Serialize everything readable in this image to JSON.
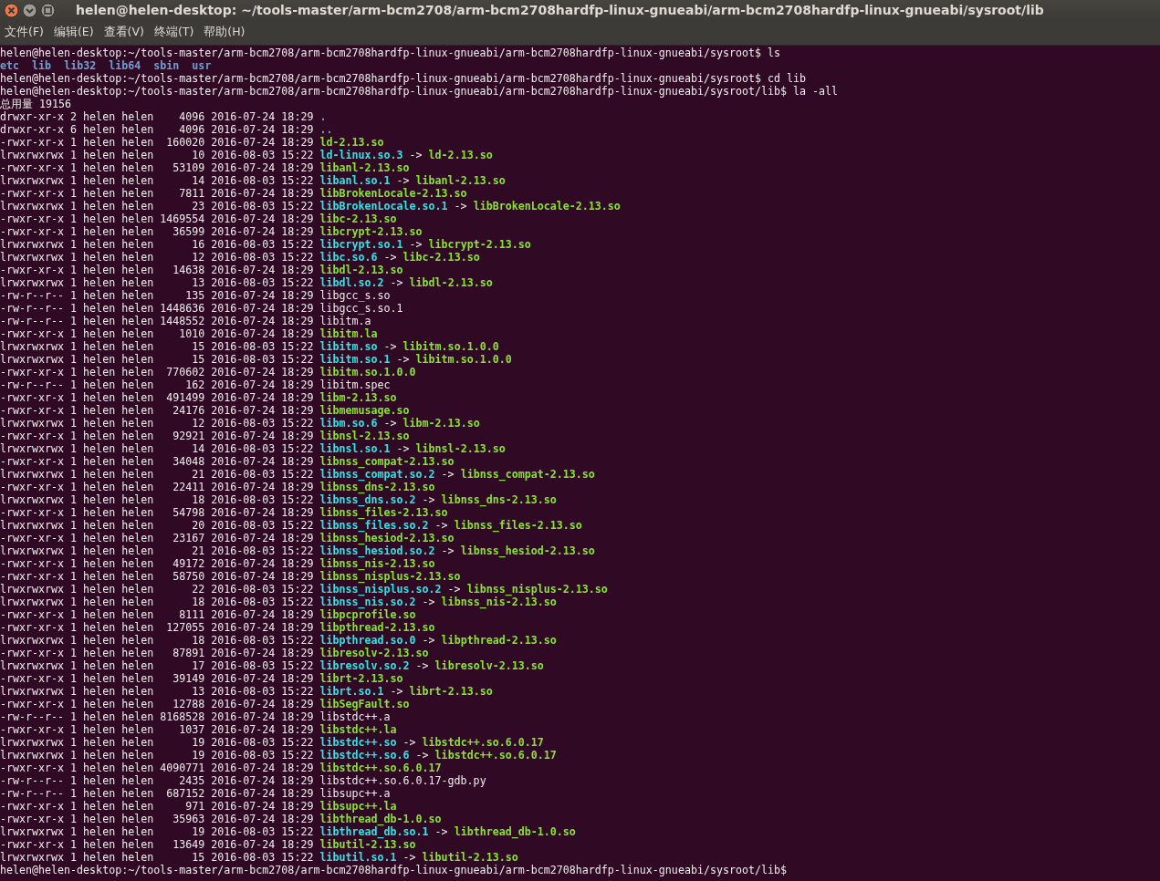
{
  "window": {
    "title": "helen@helen-desktop: ~/tools-master/arm-bcm2708/arm-bcm2708hardfp-linux-gnueabi/arm-bcm2708hardfp-linux-gnueabi/sysroot/lib"
  },
  "menu": [
    "文件(F)",
    "编辑(E)",
    "查看(V)",
    "终端(T)",
    "帮助(H)"
  ],
  "terminal": {
    "lines": [
      {
        "kind": "prompt",
        "text": "helen@helen-desktop:~/tools-master/arm-bcm2708/arm-bcm2708hardfp-linux-gnueabi/arm-bcm2708hardfp-linux-gnueabi/sysroot$ ls"
      },
      {
        "kind": "names",
        "items": [
          "etc",
          "lib",
          "lib32",
          "lib64",
          "sbin",
          "usr"
        ]
      },
      {
        "kind": "prompt",
        "text": "helen@helen-desktop:~/tools-master/arm-bcm2708/arm-bcm2708hardfp-linux-gnueabi/arm-bcm2708hardfp-linux-gnueabi/sysroot$ cd lib"
      },
      {
        "kind": "prompt",
        "text": "helen@helen-desktop:~/tools-master/arm-bcm2708/arm-bcm2708hardfp-linux-gnueabi/arm-bcm2708hardfp-linux-gnueabi/sysroot/lib$ la -all"
      },
      {
        "kind": "total",
        "text": "总用量 19156"
      },
      {
        "kind": "dir",
        "info": "drwxr-xr-x 2 helen helen    4096 2016-07-24 18:29",
        "name": "."
      },
      {
        "kind": "dir",
        "info": "drwxr-xr-x 6 helen helen    4096 2016-07-24 18:29",
        "name": ".."
      },
      {
        "kind": "exec",
        "info": "-rwxr-xr-x 1 helen helen  160020 2016-07-24 18:29",
        "name": "ld-2.13.so"
      },
      {
        "kind": "link",
        "info": "lrwxrwxrwx 1 helen helen      10 2016-08-03 15:22",
        "name": "ld-linux.so.3",
        "arrow": "->",
        "target": "ld-2.13.so"
      },
      {
        "kind": "exec",
        "info": "-rwxr-xr-x 1 helen helen   53109 2016-07-24 18:29",
        "name": "libanl-2.13.so"
      },
      {
        "kind": "link",
        "info": "lrwxrwxrwx 1 helen helen      14 2016-08-03 15:22",
        "name": "libanl.so.1",
        "arrow": "->",
        "target": "libanl-2.13.so"
      },
      {
        "kind": "exec",
        "info": "-rwxr-xr-x 1 helen helen    7811 2016-07-24 18:29",
        "name": "libBrokenLocale-2.13.so"
      },
      {
        "kind": "link",
        "info": "lrwxrwxrwx 1 helen helen      23 2016-08-03 15:22",
        "name": "libBrokenLocale.so.1",
        "arrow": "->",
        "target": "libBrokenLocale-2.13.so"
      },
      {
        "kind": "exec",
        "info": "-rwxr-xr-x 1 helen helen 1469554 2016-07-24 18:29",
        "name": "libc-2.13.so"
      },
      {
        "kind": "exec",
        "info": "-rwxr-xr-x 1 helen helen   36599 2016-07-24 18:29",
        "name": "libcrypt-2.13.so"
      },
      {
        "kind": "link",
        "info": "lrwxrwxrwx 1 helen helen      16 2016-08-03 15:22",
        "name": "libcrypt.so.1",
        "arrow": "->",
        "target": "libcrypt-2.13.so"
      },
      {
        "kind": "link",
        "info": "lrwxrwxrwx 1 helen helen      12 2016-08-03 15:22",
        "name": "libc.so.6",
        "arrow": "->",
        "target": "libc-2.13.so"
      },
      {
        "kind": "exec",
        "info": "-rwxr-xr-x 1 helen helen   14638 2016-07-24 18:29",
        "name": "libdl-2.13.so"
      },
      {
        "kind": "link",
        "info": "lrwxrwxrwx 1 helen helen      13 2016-08-03 15:22",
        "name": "libdl.so.2",
        "arrow": "->",
        "target": "libdl-2.13.so"
      },
      {
        "kind": "file",
        "info": "-rw-r--r-- 1 helen helen     135 2016-07-24 18:29",
        "name": "libgcc_s.so"
      },
      {
        "kind": "file",
        "info": "-rw-r--r-- 1 helen helen 1448636 2016-07-24 18:29",
        "name": "libgcc_s.so.1"
      },
      {
        "kind": "file",
        "info": "-rw-r--r-- 1 helen helen 1448552 2016-07-24 18:29",
        "name": "libitm.a"
      },
      {
        "kind": "exec",
        "info": "-rwxr-xr-x 1 helen helen    1010 2016-07-24 18:29",
        "name": "libitm.la"
      },
      {
        "kind": "link",
        "info": "lrwxrwxrwx 1 helen helen      15 2016-08-03 15:22",
        "name": "libitm.so",
        "arrow": "->",
        "target": "libitm.so.1.0.0"
      },
      {
        "kind": "link",
        "info": "lrwxrwxrwx 1 helen helen      15 2016-08-03 15:22",
        "name": "libitm.so.1",
        "arrow": "->",
        "target": "libitm.so.1.0.0"
      },
      {
        "kind": "exec",
        "info": "-rwxr-xr-x 1 helen helen  770602 2016-07-24 18:29",
        "name": "libitm.so.1.0.0"
      },
      {
        "kind": "file",
        "info": "-rw-r--r-- 1 helen helen     162 2016-07-24 18:29",
        "name": "libitm.spec"
      },
      {
        "kind": "exec",
        "info": "-rwxr-xr-x 1 helen helen  491499 2016-07-24 18:29",
        "name": "libm-2.13.so"
      },
      {
        "kind": "exec",
        "info": "-rwxr-xr-x 1 helen helen   24176 2016-07-24 18:29",
        "name": "libmemusage.so"
      },
      {
        "kind": "link",
        "info": "lrwxrwxrwx 1 helen helen      12 2016-08-03 15:22",
        "name": "libm.so.6",
        "arrow": "->",
        "target": "libm-2.13.so"
      },
      {
        "kind": "exec",
        "info": "-rwxr-xr-x 1 helen helen   92921 2016-07-24 18:29",
        "name": "libnsl-2.13.so"
      },
      {
        "kind": "link",
        "info": "lrwxrwxrwx 1 helen helen      14 2016-08-03 15:22",
        "name": "libnsl.so.1",
        "arrow": "->",
        "target": "libnsl-2.13.so"
      },
      {
        "kind": "exec",
        "info": "-rwxr-xr-x 1 helen helen   34048 2016-07-24 18:29",
        "name": "libnss_compat-2.13.so"
      },
      {
        "kind": "link",
        "info": "lrwxrwxrwx 1 helen helen      21 2016-08-03 15:22",
        "name": "libnss_compat.so.2",
        "arrow": "->",
        "target": "libnss_compat-2.13.so"
      },
      {
        "kind": "exec",
        "info": "-rwxr-xr-x 1 helen helen   22411 2016-07-24 18:29",
        "name": "libnss_dns-2.13.so"
      },
      {
        "kind": "link",
        "info": "lrwxrwxrwx 1 helen helen      18 2016-08-03 15:22",
        "name": "libnss_dns.so.2",
        "arrow": "->",
        "target": "libnss_dns-2.13.so"
      },
      {
        "kind": "exec",
        "info": "-rwxr-xr-x 1 helen helen   54798 2016-07-24 18:29",
        "name": "libnss_files-2.13.so"
      },
      {
        "kind": "link",
        "info": "lrwxrwxrwx 1 helen helen      20 2016-08-03 15:22",
        "name": "libnss_files.so.2",
        "arrow": "->",
        "target": "libnss_files-2.13.so"
      },
      {
        "kind": "exec",
        "info": "-rwxr-xr-x 1 helen helen   23167 2016-07-24 18:29",
        "name": "libnss_hesiod-2.13.so"
      },
      {
        "kind": "link",
        "info": "lrwxrwxrwx 1 helen helen      21 2016-08-03 15:22",
        "name": "libnss_hesiod.so.2",
        "arrow": "->",
        "target": "libnss_hesiod-2.13.so"
      },
      {
        "kind": "exec",
        "info": "-rwxr-xr-x 1 helen helen   49172 2016-07-24 18:29",
        "name": "libnss_nis-2.13.so"
      },
      {
        "kind": "exec",
        "info": "-rwxr-xr-x 1 helen helen   58750 2016-07-24 18:29",
        "name": "libnss_nisplus-2.13.so"
      },
      {
        "kind": "link",
        "info": "lrwxrwxrwx 1 helen helen      22 2016-08-03 15:22",
        "name": "libnss_nisplus.so.2",
        "arrow": "->",
        "target": "libnss_nisplus-2.13.so"
      },
      {
        "kind": "link",
        "info": "lrwxrwxrwx 1 helen helen      18 2016-08-03 15:22",
        "name": "libnss_nis.so.2",
        "arrow": "->",
        "target": "libnss_nis-2.13.so"
      },
      {
        "kind": "exec",
        "info": "-rwxr-xr-x 1 helen helen    8111 2016-07-24 18:29",
        "name": "libpcprofile.so"
      },
      {
        "kind": "exec",
        "info": "-rwxr-xr-x 1 helen helen  127055 2016-07-24 18:29",
        "name": "libpthread-2.13.so"
      },
      {
        "kind": "link",
        "info": "lrwxrwxrwx 1 helen helen      18 2016-08-03 15:22",
        "name": "libpthread.so.0",
        "arrow": "->",
        "target": "libpthread-2.13.so"
      },
      {
        "kind": "exec",
        "info": "-rwxr-xr-x 1 helen helen   87891 2016-07-24 18:29",
        "name": "libresolv-2.13.so"
      },
      {
        "kind": "link",
        "info": "lrwxrwxrwx 1 helen helen      17 2016-08-03 15:22",
        "name": "libresolv.so.2",
        "arrow": "->",
        "target": "libresolv-2.13.so"
      },
      {
        "kind": "exec",
        "info": "-rwxr-xr-x 1 helen helen   39149 2016-07-24 18:29",
        "name": "librt-2.13.so"
      },
      {
        "kind": "link",
        "info": "lrwxrwxrwx 1 helen helen      13 2016-08-03 15:22",
        "name": "librt.so.1",
        "arrow": "->",
        "target": "librt-2.13.so"
      },
      {
        "kind": "exec",
        "info": "-rwxr-xr-x 1 helen helen   12788 2016-07-24 18:29",
        "name": "libSegFault.so"
      },
      {
        "kind": "file",
        "info": "-rw-r--r-- 1 helen helen 8168528 2016-07-24 18:29",
        "name": "libstdc++.a"
      },
      {
        "kind": "exec",
        "info": "-rwxr-xr-x 1 helen helen    1037 2016-07-24 18:29",
        "name": "libstdc++.la"
      },
      {
        "kind": "link",
        "info": "lrwxrwxrwx 1 helen helen      19 2016-08-03 15:22",
        "name": "libstdc++.so",
        "arrow": "->",
        "target": "libstdc++.so.6.0.17"
      },
      {
        "kind": "link",
        "info": "lrwxrwxrwx 1 helen helen      19 2016-08-03 15:22",
        "name": "libstdc++.so.6",
        "arrow": "->",
        "target": "libstdc++.so.6.0.17"
      },
      {
        "kind": "exec",
        "info": "-rwxr-xr-x 1 helen helen 4090771 2016-07-24 18:29",
        "name": "libstdc++.so.6.0.17"
      },
      {
        "kind": "file",
        "info": "-rw-r--r-- 1 helen helen    2435 2016-07-24 18:29",
        "name": "libstdc++.so.6.0.17-gdb.py"
      },
      {
        "kind": "file",
        "info": "-rw-r--r-- 1 helen helen  687152 2016-07-24 18:29",
        "name": "libsupc++.a"
      },
      {
        "kind": "exec",
        "info": "-rwxr-xr-x 1 helen helen     971 2016-07-24 18:29",
        "name": "libsupc++.la"
      },
      {
        "kind": "exec",
        "info": "-rwxr-xr-x 1 helen helen   35963 2016-07-24 18:29",
        "name": "libthread_db-1.0.so"
      },
      {
        "kind": "link",
        "info": "lrwxrwxrwx 1 helen helen      19 2016-08-03 15:22",
        "name": "libthread_db.so.1",
        "arrow": "->",
        "target": "libthread_db-1.0.so"
      },
      {
        "kind": "exec",
        "info": "-rwxr-xr-x 1 helen helen   13649 2016-07-24 18:29",
        "name": "libutil-2.13.so"
      },
      {
        "kind": "link",
        "info": "lrwxrwxrwx 1 helen helen      15 2016-08-03 15:22",
        "name": "libutil.so.1",
        "arrow": "->",
        "target": "libutil-2.13.so"
      },
      {
        "kind": "prompt",
        "text": "helen@helen-desktop:~/tools-master/arm-bcm2708/arm-bcm2708hardfp-linux-gnueabi/arm-bcm2708hardfp-linux-gnueabi/sysroot/lib$"
      }
    ]
  }
}
